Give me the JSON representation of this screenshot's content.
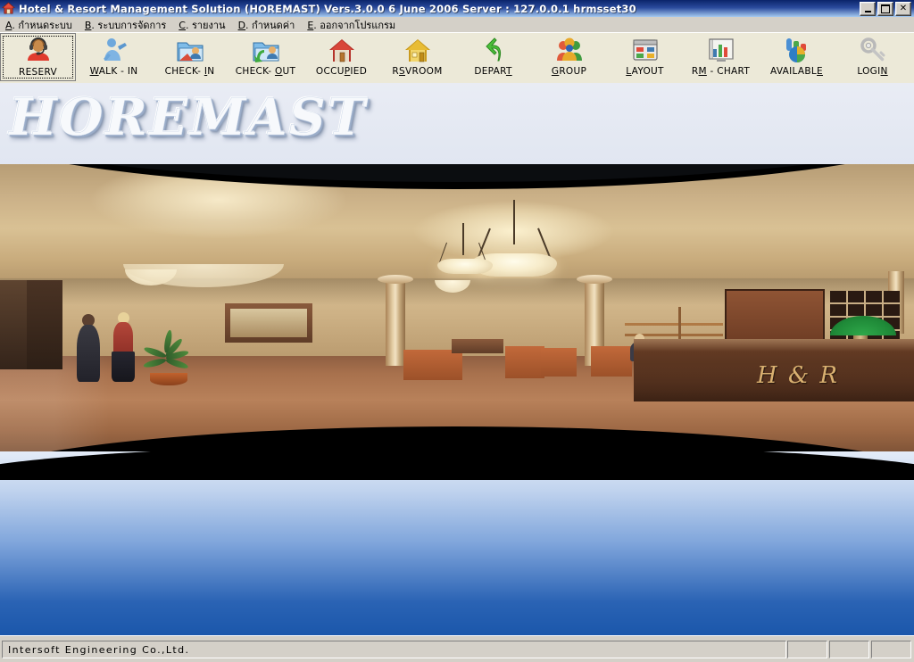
{
  "window": {
    "title": "Hotel & Resort Management Solution (HOREMAST)   Vers.3.0.0   6 June 2006   Server : 127.0.0.1  hrmsset30",
    "app_icon": "house-icon",
    "minimize_label": "Minimize",
    "restore_label": "Restore",
    "close_label": "Close",
    "close_glyph": "✕",
    "titlebar_color": "#0a246a"
  },
  "menu": {
    "items": [
      {
        "accel": "A",
        "label": ". กำหนดระบบ",
        "name": "menu-system-setup"
      },
      {
        "accel": "B",
        "label": ". ระบบการจัดการ",
        "name": "menu-management-system"
      },
      {
        "accel": "C",
        "label": ". รายงาน",
        "name": "menu-reports"
      },
      {
        "accel": "D",
        "label": ". กำหนดค่า",
        "name": "menu-configuration"
      },
      {
        "accel": "E",
        "label": ". ออกจากโปรแกรม",
        "name": "menu-exit-program"
      }
    ]
  },
  "toolbar": {
    "buttons": [
      {
        "pre": "",
        "accel": "",
        "post": "RESERV",
        "icon": "agent-headset-icon",
        "name": "toolbar-reserv",
        "focused": true
      },
      {
        "pre": "",
        "accel": "W",
        "post": "ALK - IN",
        "icon": "walkin-person-icon",
        "name": "toolbar-walk-in",
        "focused": false
      },
      {
        "pre": "CHECK- ",
        "accel": "I",
        "post": "N",
        "icon": "checkin-folder-icon",
        "name": "toolbar-check-in",
        "focused": false
      },
      {
        "pre": "CHECK- ",
        "accel": "O",
        "post": "UT",
        "icon": "checkout-folder-icon",
        "name": "toolbar-check-out",
        "focused": false
      },
      {
        "pre": "OCCU",
        "accel": "P",
        "post": "IED",
        "icon": "red-house-icon",
        "name": "toolbar-occupied",
        "focused": false
      },
      {
        "pre": "R",
        "accel": "S",
        "post": "VROOM",
        "icon": "yellow-house-icon",
        "name": "toolbar-rsvroom",
        "focused": false
      },
      {
        "pre": "DEPAR",
        "accel": "T",
        "post": "",
        "icon": "green-arrow-icon",
        "name": "toolbar-depart",
        "focused": false
      },
      {
        "pre": "",
        "accel": "G",
        "post": "ROUP",
        "icon": "group-people-icon",
        "name": "toolbar-group",
        "focused": false
      },
      {
        "pre": "",
        "accel": "L",
        "post": "AYOUT",
        "icon": "layout-window-icon",
        "name": "toolbar-layout",
        "focused": false
      },
      {
        "pre": "R",
        "accel": "M",
        "post": " - CHART",
        "icon": "bar-chart-icon",
        "name": "toolbar-rm-chart",
        "focused": false
      },
      {
        "pre": "AVAILABL",
        "accel": "E",
        "post": "",
        "icon": "pie-chart-icon",
        "name": "toolbar-available",
        "focused": false
      },
      {
        "pre": "LOGI",
        "accel": "N",
        "post": "",
        "icon": "key-icon",
        "name": "toolbar-login",
        "focused": false
      }
    ]
  },
  "main": {
    "logo_text": "HOREMAST",
    "desk_monogram": "H & R",
    "background_top_color": "#e9ecf4",
    "background_blue_color": "#1b57ab"
  },
  "statusbar": {
    "company": "Intersoft Engineering Co.,Ltd.",
    "panel1": "",
    "panel2": "",
    "panel3": ""
  }
}
